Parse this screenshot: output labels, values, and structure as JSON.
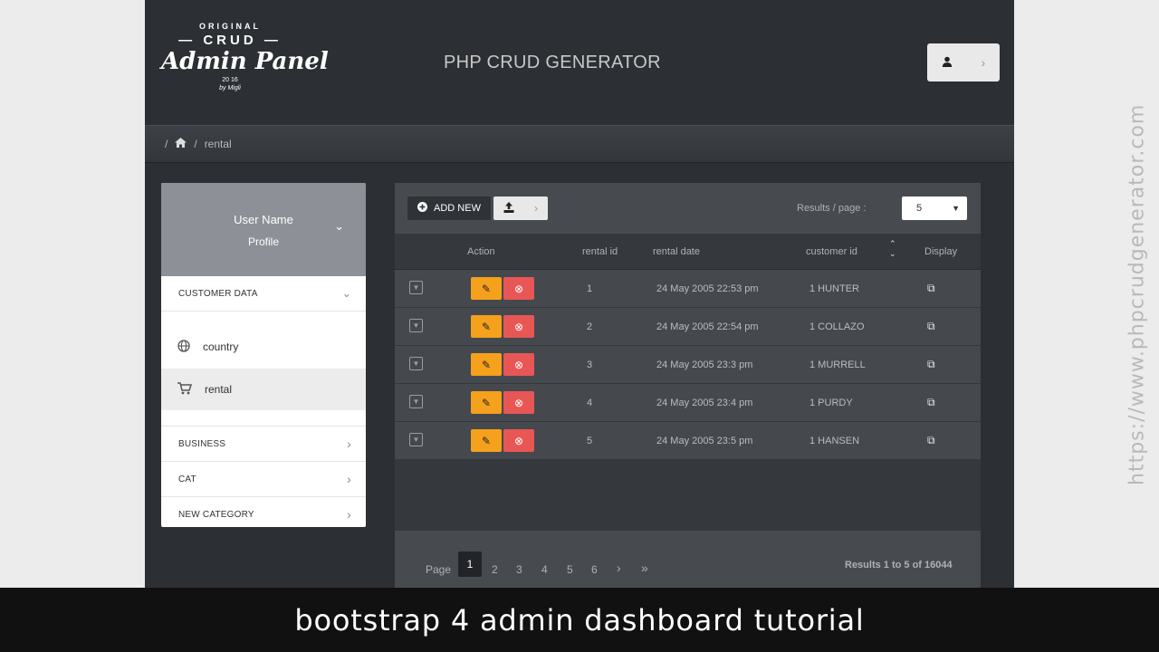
{
  "logo": {
    "line1": "ORIGINAL",
    "line2": "— CRUD —",
    "line3": "Admin Panel",
    "line4": "20  16",
    "line5": "by Migli"
  },
  "header": {
    "title": "PHP CRUD GENERATOR"
  },
  "breadcrumb": {
    "sep1": "/",
    "sep2": "/",
    "current": "rental"
  },
  "sidebar": {
    "user_name": "User Name",
    "profile": "Profile",
    "sections": [
      {
        "label": "CUSTOMER DATA"
      },
      {
        "label": "BUSINESS"
      },
      {
        "label": "CAT"
      },
      {
        "label": "NEW CATEGORY"
      }
    ],
    "items": [
      {
        "label": "country",
        "icon": "globe-icon"
      },
      {
        "label": "rental",
        "icon": "cart-icon"
      }
    ]
  },
  "toolbar": {
    "add_label": "ADD NEW",
    "rpp_label": "Results / page :",
    "rpp_value": "5"
  },
  "table": {
    "headers": {
      "action": "Action",
      "id": "rental id",
      "date": "rental date",
      "customer": "customer id",
      "display": "Display"
    },
    "rows": [
      {
        "id": "1",
        "date": "24 May 2005 22:53 pm",
        "customer": "1 HUNTER"
      },
      {
        "id": "2",
        "date": "24 May 2005 22:54 pm",
        "customer": "1 COLLAZO"
      },
      {
        "id": "3",
        "date": "24 May 2005 23:3 pm",
        "customer": "1 MURRELL"
      },
      {
        "id": "4",
        "date": "24 May 2005 23:4 pm",
        "customer": "1 PURDY"
      },
      {
        "id": "5",
        "date": "24 May 2005 23:5 pm",
        "customer": "1 HANSEN"
      }
    ]
  },
  "pagination": {
    "label": "Page",
    "current": "1",
    "pages": [
      "2",
      "3",
      "4",
      "5",
      "6"
    ],
    "next": "›",
    "last": "»",
    "results": "Results 1 to 5 of 16044"
  },
  "caption": "bootstrap 4 admin dashboard tutorial",
  "watermark": "https://www.phpcrudgenerator.com",
  "colors": {
    "edit": "#f5a11c",
    "delete": "#e95656",
    "sidebar_profile": "#8d9197"
  }
}
